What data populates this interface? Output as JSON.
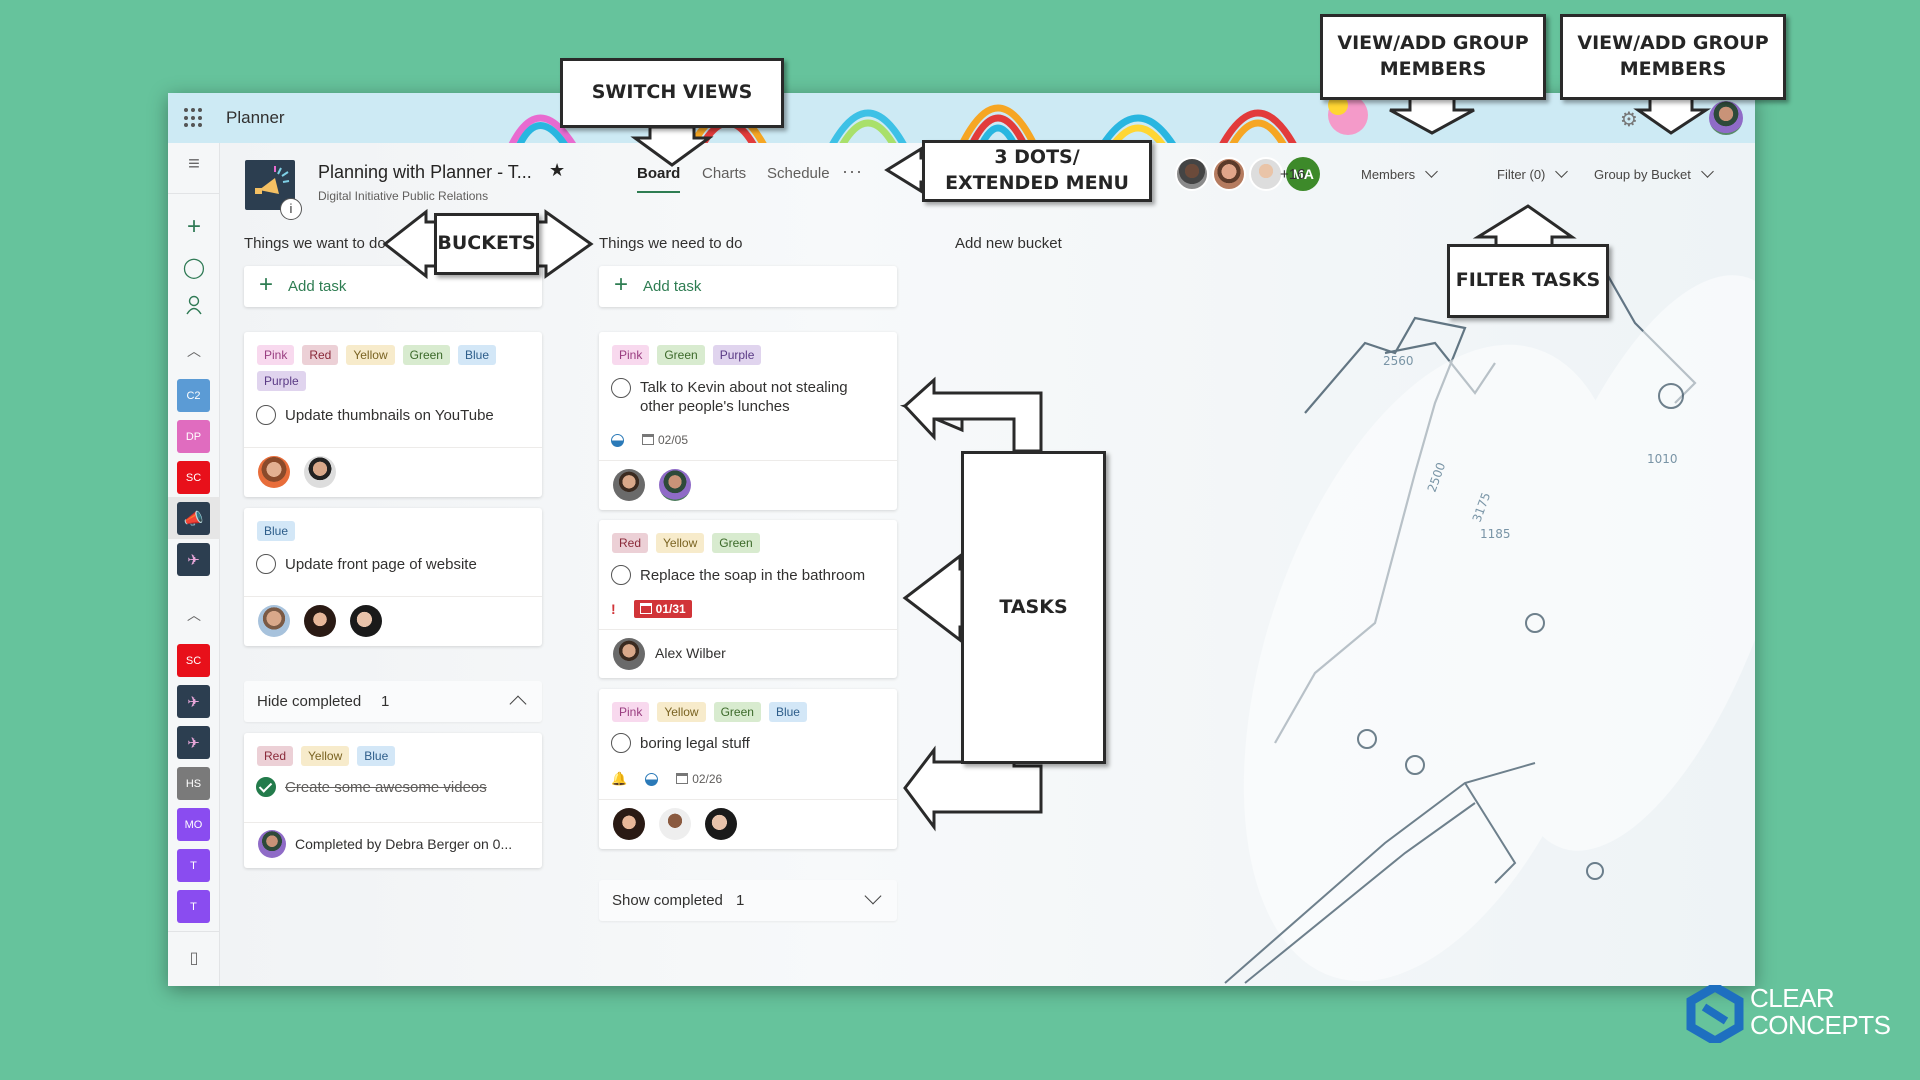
{
  "app": {
    "name": "Planner",
    "settings_icon": "gear-icon",
    "waffle_icon": "app-launcher-icon"
  },
  "plan": {
    "title": "Planning with Planner - T...",
    "group": "Digital Initiative Public Relations",
    "favorite_icon": "star-icon",
    "info_label": "i"
  },
  "views": {
    "tabs": [
      {
        "label": "Board",
        "active": true
      },
      {
        "label": "Charts",
        "active": false
      },
      {
        "label": "Schedule",
        "active": false
      }
    ],
    "more": "···"
  },
  "members": {
    "initials_avatar": "MA",
    "extra_count": "+16",
    "members_label": "Members",
    "filter_label": "Filter (0)",
    "group_by_label": "Group by Bucket"
  },
  "rail": {
    "icons": [
      "hamburger-icon",
      "plus-icon",
      "circle-icon",
      "person-icon"
    ],
    "section1": [
      {
        "initials": "C2",
        "color": "#5b9bd5"
      },
      {
        "initials": "DP",
        "color": "#e06cbf"
      },
      {
        "initials": "SC",
        "color": "#e8101a"
      },
      {
        "initials": "",
        "color": "#2c3e50",
        "icon": "megaphone-icon",
        "selected": true
      },
      {
        "initials": "",
        "color": "#2c3e50",
        "icon": "drone-icon"
      }
    ],
    "section2": [
      {
        "initials": "SC",
        "color": "#e8101a"
      },
      {
        "initials": "",
        "color": "#2c3e50",
        "icon": "drone-icon"
      },
      {
        "initials": "",
        "color": "#2c3e50",
        "icon": "drone-icon"
      },
      {
        "initials": "HS",
        "color": "#7a7a7a"
      },
      {
        "initials": "MO",
        "color": "#8a4cf0"
      },
      {
        "initials": "T",
        "color": "#8a4cf0"
      },
      {
        "initials": "T",
        "color": "#8a4cf0"
      }
    ],
    "mobile_icon": "phone-icon"
  },
  "buckets": [
    {
      "title": "Things we want to do",
      "add_task": "Add task",
      "tasks": [
        {
          "labels": [
            "Pink",
            "Red",
            "Yellow",
            "Green",
            "Blue",
            "Purple"
          ],
          "title": "Update thumbnails on YouTube",
          "assignees": 2
        },
        {
          "labels": [
            "Blue"
          ],
          "title": "Update front page of website",
          "assignees": 3
        }
      ],
      "completed_toggle": {
        "label": "Hide completed",
        "count": "1"
      },
      "completed_tasks": [
        {
          "labels": [
            "Red",
            "Yellow",
            "Blue"
          ],
          "title": "Create some awesome videos",
          "completed_by": "Completed by Debra Berger on 0..."
        }
      ]
    },
    {
      "title": "Things we need to do",
      "add_task": "Add task",
      "tasks": [
        {
          "labels": [
            "Pink",
            "Green",
            "Purple"
          ],
          "title": "Talk to Kevin about not stealing other people's lunches",
          "progress": "in-progress",
          "due": "02/05",
          "assignees": 2
        },
        {
          "labels": [
            "Red",
            "Yellow",
            "Green"
          ],
          "title": "Replace the soap in the bathroom",
          "priority": "!",
          "due": "01/31",
          "overdue": true,
          "assignee_name": "Alex Wilber"
        },
        {
          "labels": [
            "Pink",
            "Yellow",
            "Green",
            "Blue"
          ],
          "title": "boring legal stuff",
          "priority_icon": "urgent-bell-icon",
          "progress": "in-progress",
          "due": "02/26",
          "assignees": 3
        }
      ],
      "completed_toggle": {
        "label": "Show completed",
        "count": "1"
      }
    }
  ],
  "add_bucket": "Add new bucket",
  "callouts": {
    "switch_views": "SWITCH VIEWS",
    "extended_menu": "3 DOTS/ EXTENDED MENU",
    "buckets": "BUCKETS",
    "members1": "VIEW/ADD GROUP MEMBERS",
    "members2": "VIEW/ADD GROUP MEMBERS",
    "filter": "FILTER TASKS",
    "tasks": "TASKS"
  },
  "brand": {
    "line1": "CLEAR",
    "line2": "CONCEPTS",
    "accent": "#2e7d52"
  }
}
